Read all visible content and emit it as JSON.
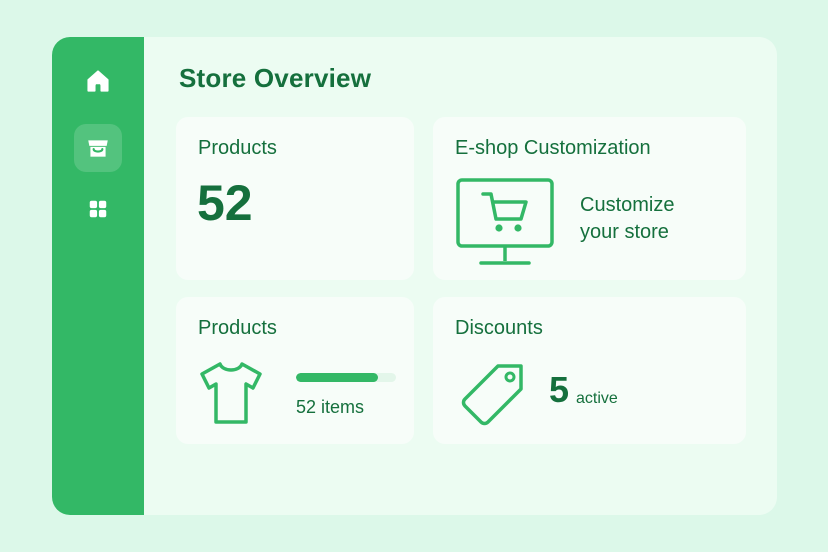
{
  "colors": {
    "background": "#dcf8e9",
    "sidebar": "#33b866",
    "accent": "#15703d",
    "card": "#f7fdf9"
  },
  "sidebar": {
    "items": [
      {
        "icon": "home-icon",
        "active": false
      },
      {
        "icon": "store-icon",
        "active": true
      },
      {
        "icon": "grid-icon",
        "active": false
      }
    ]
  },
  "header": {
    "title": "Store Overview"
  },
  "cards": {
    "products_count": {
      "title": "Products",
      "value": "52"
    },
    "customization": {
      "title": "E-shop Customization",
      "icon": "monitor-cart-icon",
      "text_line1": "Customize",
      "text_line2": "your store"
    },
    "products_items": {
      "title": "Products",
      "icon": "tshirt-icon",
      "items_label": "52 items",
      "progress_fraction": 0.82
    },
    "discounts": {
      "title": "Discounts",
      "icon": "price-tag-icon",
      "count": "5",
      "status": "active"
    }
  }
}
